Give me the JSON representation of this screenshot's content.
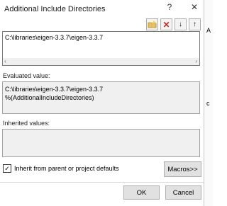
{
  "window": {
    "title": "Additional Include Directories",
    "help_glyph": "?",
    "close_glyph": "✕"
  },
  "toolbar": {
    "new_line_icon": "folder-new-icon",
    "delete_icon": "delete-icon",
    "down_icon": "move-down-icon",
    "up_icon": "move-up-icon"
  },
  "editor": {
    "value": "C:\\libraries\\eigen-3.3.7\\eigen-3.3.7"
  },
  "evaluated": {
    "label": "Evaluated value:",
    "lines": [
      "C:\\libraries\\eigen-3.3.7\\eigen-3.3.7",
      "%(AdditionalIncludeDirectories)"
    ]
  },
  "inherited": {
    "label": "Inherited values:"
  },
  "inherit_checkbox": {
    "label": "Inherit from parent or project defaults",
    "checked": true
  },
  "buttons": {
    "macros": "Macros>>",
    "ok": "OK",
    "cancel": "Cancel"
  },
  "side_text": [
    "A",
    "c"
  ]
}
